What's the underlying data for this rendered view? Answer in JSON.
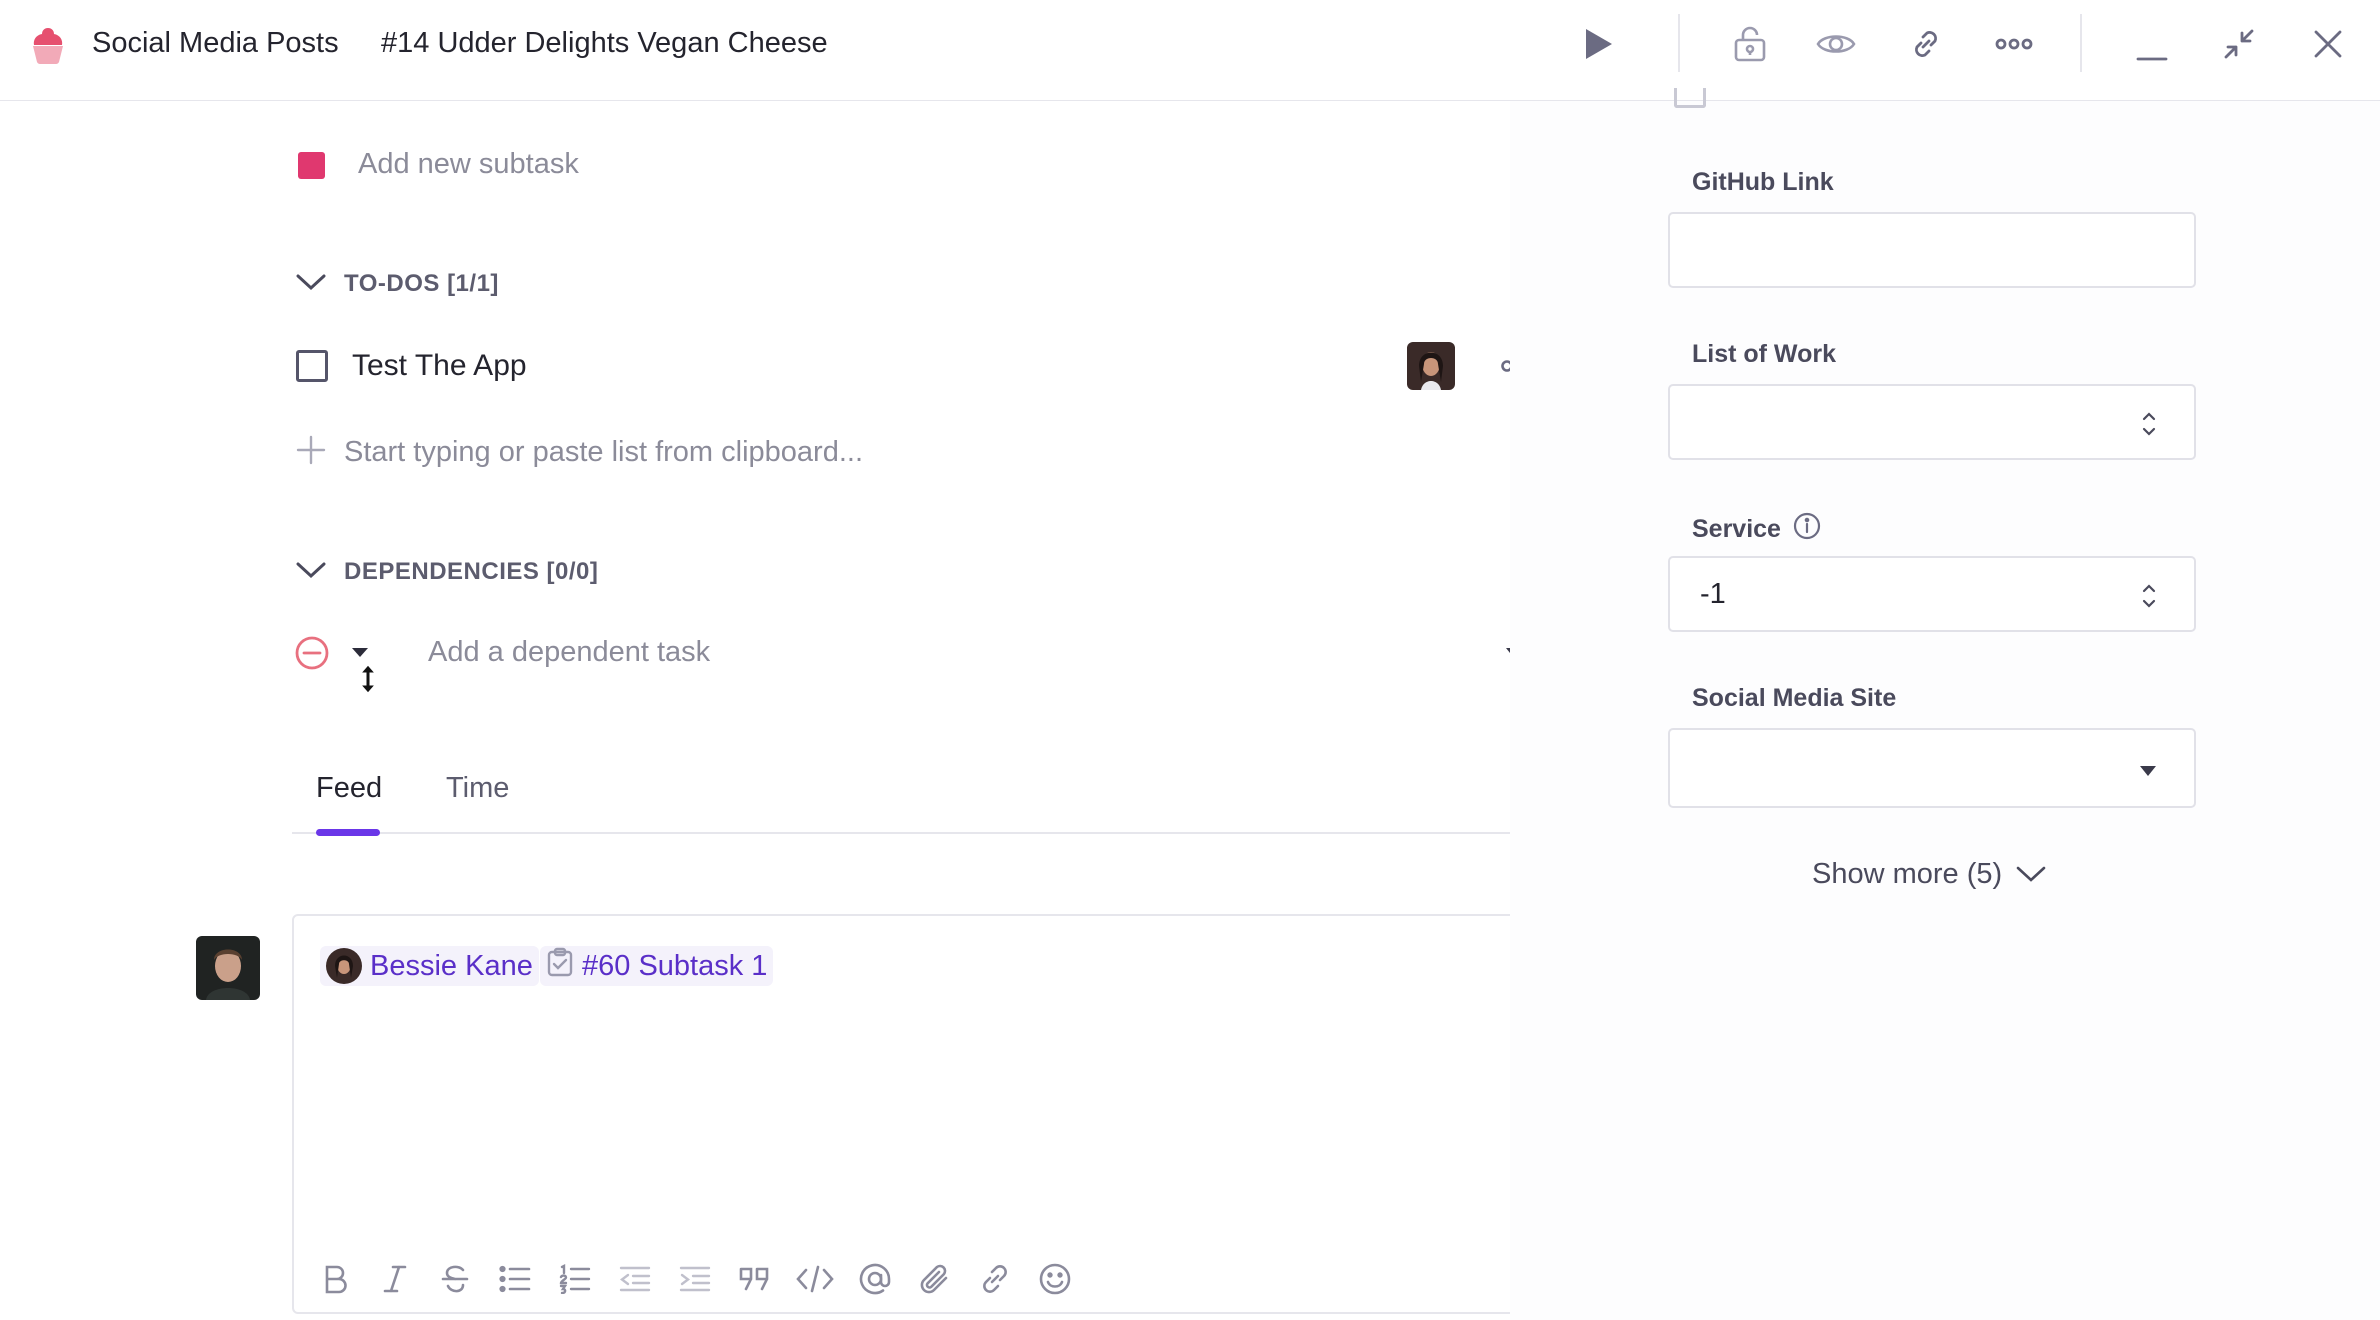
{
  "header": {
    "project": "Social Media Posts",
    "task_title": "#14 Udder Delights Vegan Cheese",
    "icons": [
      "play-icon",
      "lock-icon",
      "eye-icon",
      "link-icon",
      "more-icon",
      "minimize-icon",
      "collapse-icon",
      "close-icon"
    ]
  },
  "subtask": {
    "placeholder": "Add new subtask",
    "color": "#e0386f"
  },
  "todos": {
    "header": "TO-DOS [1/1]",
    "items": [
      {
        "text": "Test The App",
        "checked": false
      }
    ],
    "add_placeholder": "Start typing or paste list from clipboard..."
  },
  "dependencies": {
    "header": "DEPENDENCIES [0/0]",
    "placeholder": "Add a dependent task"
  },
  "tabs": [
    {
      "label": "Feed",
      "active": true
    },
    {
      "label": "Time",
      "active": false
    }
  ],
  "editor": {
    "mention_user": "Bessie Kane",
    "mention_task": "#60 Subtask 1",
    "toolbar": [
      "bold-icon",
      "italic-icon",
      "strikethrough-icon",
      "bullet-list-icon",
      "numbered-list-icon",
      "outdent-icon",
      "indent-icon",
      "quote-icon",
      "code-icon",
      "mention-icon",
      "attachment-icon",
      "link-icon",
      "emoji-icon"
    ]
  },
  "fields": {
    "github_link": {
      "label": "GitHub Link",
      "value": ""
    },
    "list_of_work": {
      "label": "List of Work",
      "value": ""
    },
    "service": {
      "label": "Service",
      "value": "-1"
    },
    "social_media_site": {
      "label": "Social Media Site",
      "value": ""
    }
  },
  "show_more": "Show more (5)",
  "colors": {
    "accent": "#6a36e8",
    "mention": "#5a2fc8",
    "danger": "#e0386f"
  }
}
